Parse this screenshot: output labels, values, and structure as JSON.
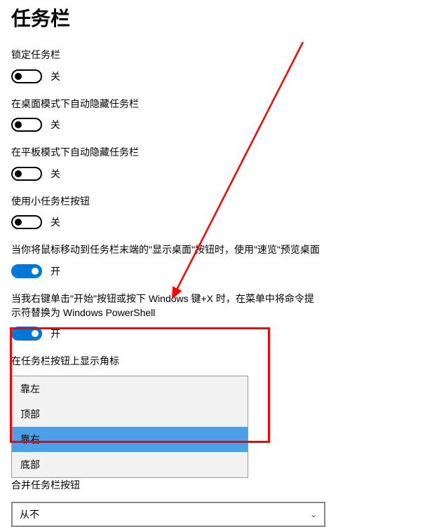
{
  "page": {
    "title": "任务栏"
  },
  "toggle_labels": {
    "off": "关",
    "on": "开"
  },
  "settings": [
    {
      "label": "锁定任务栏",
      "on": false
    },
    {
      "label": "在桌面模式下自动隐藏任务栏",
      "on": false
    },
    {
      "label": "在平板模式下自动隐藏任务栏",
      "on": false
    },
    {
      "label": "使用小任务栏按钮",
      "on": false
    },
    {
      "label": "当你将鼠标移动到任务栏末端的\"显示桌面\"按钮时，使用\"速览\"预览桌面",
      "on": true
    },
    {
      "label": "当我右键单击\"开始\"按钮或按下 Windows 键+X 时，在菜单中将命令提示符替换为 Windows PowerShell",
      "on": true
    }
  ],
  "dropdown_section": {
    "label": "在任务栏按钮上显示角标",
    "options": [
      "靠左",
      "顶部",
      "靠右",
      "底部"
    ],
    "selected_index": 2
  },
  "cutoff_section": {
    "label": "合并任务栏按钮"
  },
  "combo": {
    "value": "从不"
  }
}
